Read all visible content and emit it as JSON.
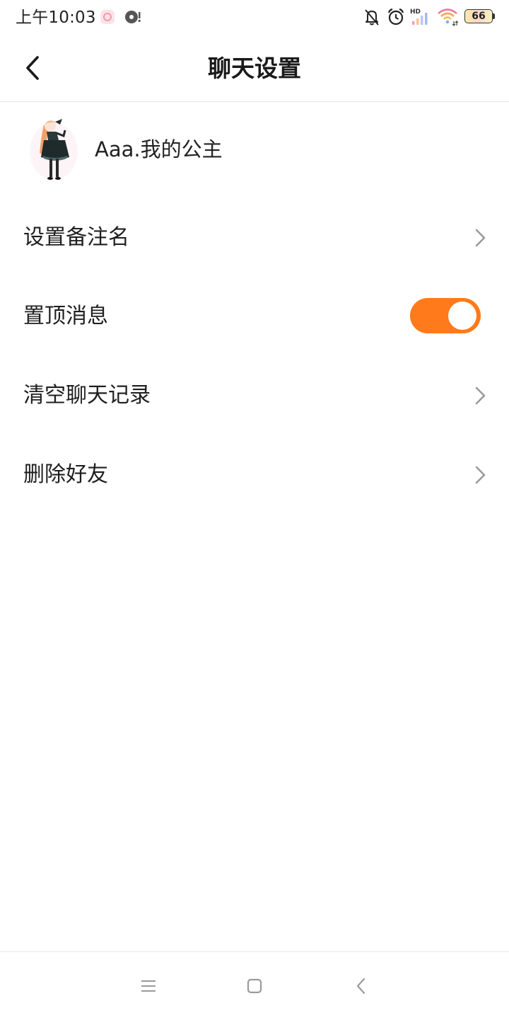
{
  "status_bar": {
    "time": "上午10:03",
    "network_badge": "HD",
    "battery": "66",
    "icons": [
      "app-notification-icon",
      "music-app-icon",
      "mute-bell-icon",
      "alarm-icon",
      "cell-signal-icon",
      "wifi-icon",
      "battery-icon"
    ]
  },
  "header": {
    "title": "聊天设置",
    "back_icon": "chevron-left-icon"
  },
  "profile": {
    "name": "Aaa.我的公主",
    "avatar_icon": "anime-girl-avatar"
  },
  "settings": {
    "items": [
      {
        "label": "设置备注名",
        "control": "chevron-right-icon"
      },
      {
        "label": "置顶消息",
        "control": "toggle",
        "toggle_on": true
      },
      {
        "label": "清空聊天记录",
        "control": "chevron-right-icon"
      },
      {
        "label": "删除好友",
        "control": "chevron-right-icon"
      }
    ]
  },
  "nav_bar": {
    "icons": [
      "menu-icon",
      "home-square-icon",
      "back-triangle-icon"
    ]
  },
  "colors": {
    "accent": "#ff7a1a",
    "text": "#1f1f1f",
    "chevron": "#9a9a9a",
    "divider": "#e6e6e6",
    "nav_icon": "#9a9a9a"
  }
}
